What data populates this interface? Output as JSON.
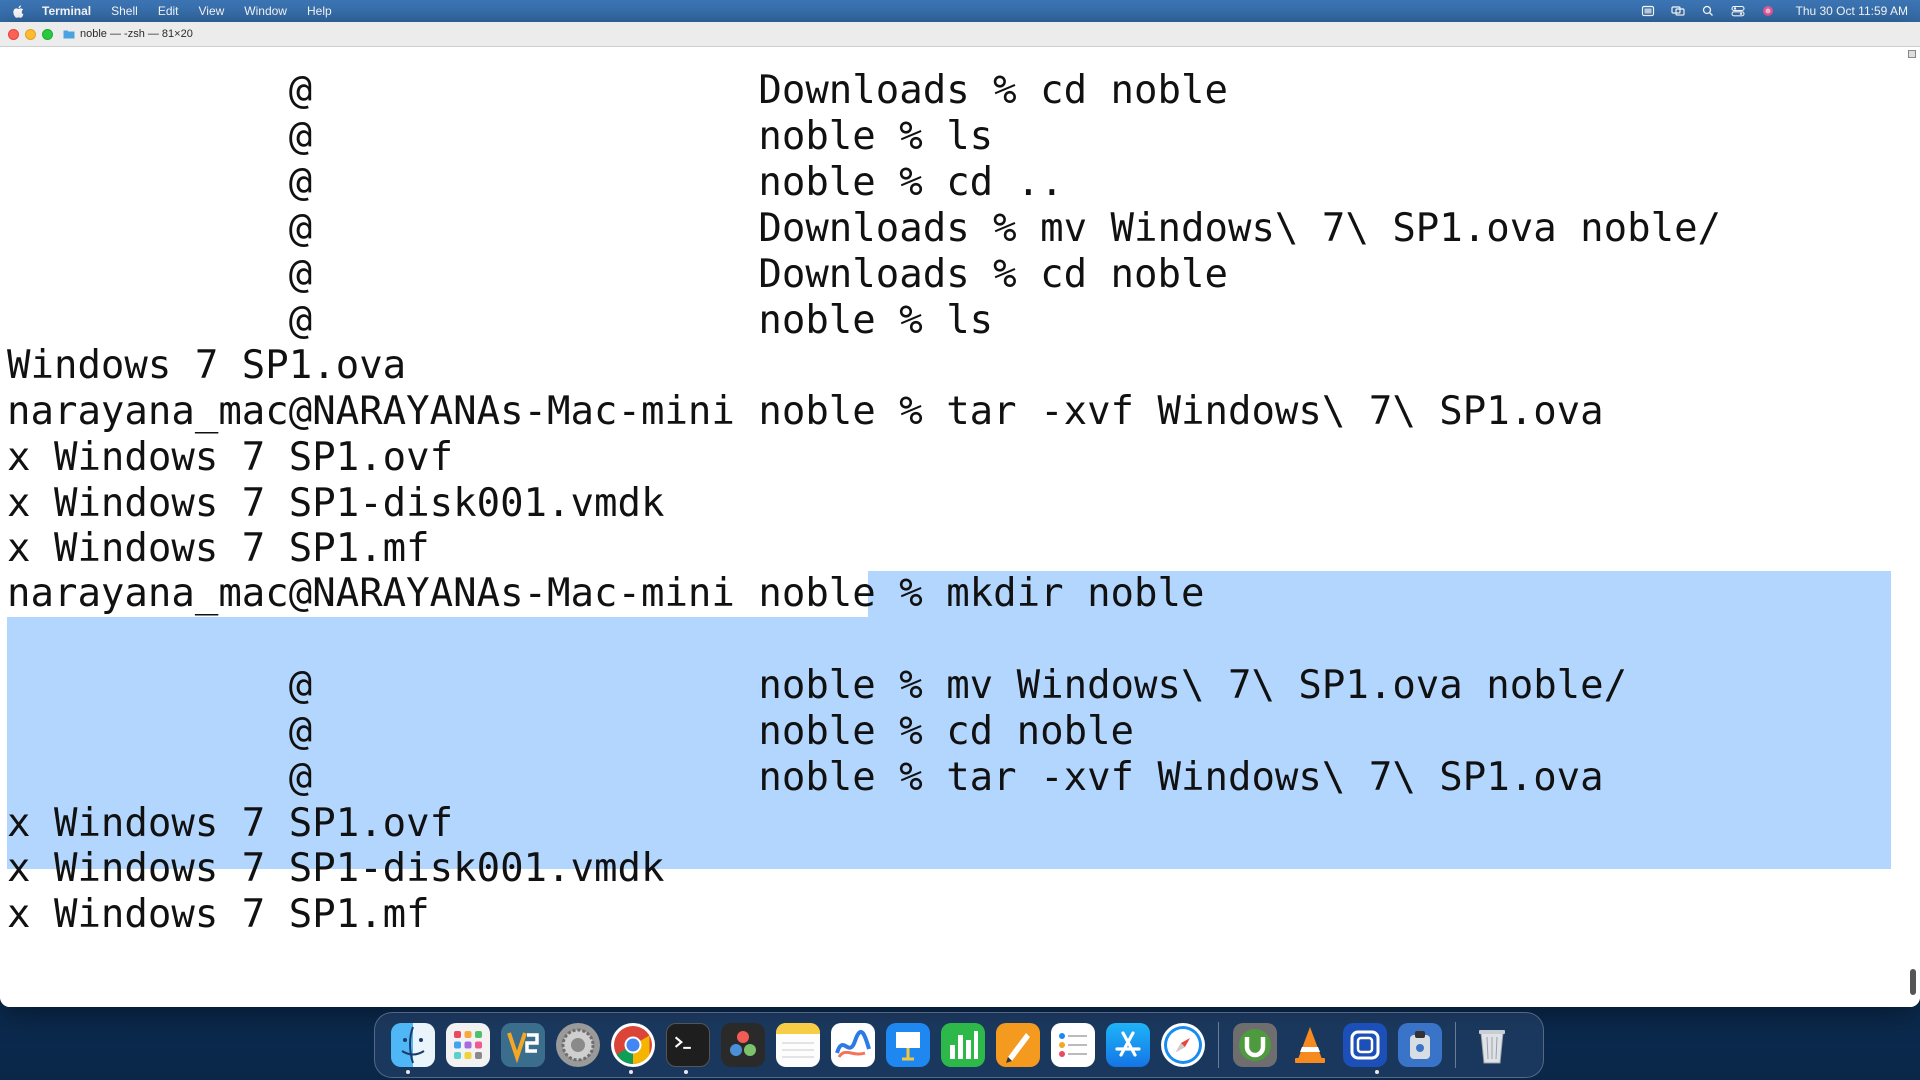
{
  "menubar": {
    "app_name": "Terminal",
    "menus": [
      "Shell",
      "Edit",
      "View",
      "Window",
      "Help"
    ],
    "clock": "Thu 30 Oct  11:59 AM"
  },
  "window": {
    "title": "noble — -zsh — 81×20"
  },
  "terminal": {
    "lines": [
      "            @                   Downloads % cd noble",
      "            @                   noble % ls",
      "            @                   noble % cd ..",
      "            @                   Downloads % mv Windows\\ 7\\ SP1.ova noble/",
      "            @                   Downloads % cd noble",
      "            @                   noble % ls",
      "Windows 7 SP1.ova",
      "narayana_mac@NARAYANAs-Mac-mini noble % tar -xvf Windows\\ 7\\ SP1.ova",
      "x Windows 7 SP1.ovf",
      "x Windows 7 SP1-disk001.vmdk",
      "x Windows 7 SP1.mf",
      "narayana_mac@NARAYANAs-Mac-mini noble % mkdir noble",
      "",
      "            @                   noble % mv Windows\\ 7\\ SP1.ova noble/",
      "            @                   noble % cd noble",
      "            @                   noble % tar -xvf Windows\\ 7\\ SP1.ova",
      "x Windows 7 SP1.ovf",
      "x Windows 7 SP1-disk001.vmdk",
      "x Windows 7 SP1.mf"
    ],
    "selection_color": "#b3d6ff"
  },
  "dock": {
    "apps": [
      {
        "name": "finder-icon",
        "label": "Finder"
      },
      {
        "name": "launchpad-icon",
        "label": "Launchpad"
      },
      {
        "name": "vs-app-icon",
        "label": "App"
      },
      {
        "name": "system-settings-icon",
        "label": "System Settings"
      },
      {
        "name": "chrome-icon",
        "label": "Google Chrome"
      },
      {
        "name": "terminal-icon",
        "label": "Terminal"
      },
      {
        "name": "davinci-resolve-icon",
        "label": "DaVinci Resolve"
      },
      {
        "name": "notes-icon",
        "label": "Notes"
      },
      {
        "name": "freeform-icon",
        "label": "Freeform"
      },
      {
        "name": "keynote-icon",
        "label": "Keynote"
      },
      {
        "name": "numbers-icon",
        "label": "Numbers"
      },
      {
        "name": "pages-icon",
        "label": "Pages"
      },
      {
        "name": "reminders-icon",
        "label": "Reminders"
      },
      {
        "name": "app-store-icon",
        "label": "App Store"
      },
      {
        "name": "safari-icon",
        "label": "Safari"
      },
      {
        "name": "utorrent-icon",
        "label": "uTorrent"
      },
      {
        "name": "vlc-icon",
        "label": "VLC"
      },
      {
        "name": "screen-app-icon",
        "label": "App"
      },
      {
        "name": "disk-utility-icon",
        "label": "App"
      },
      {
        "name": "trash-icon",
        "label": "Trash"
      }
    ]
  }
}
